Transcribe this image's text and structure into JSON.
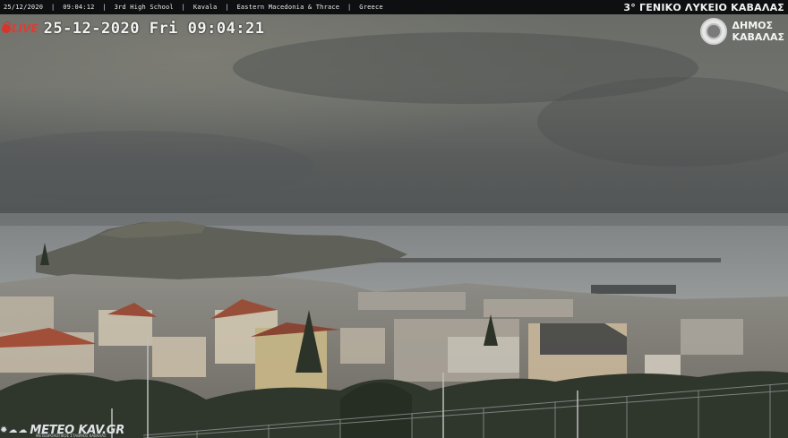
{
  "topbar": {
    "info": "25/12/2020  |  09:04:12  |  3rd High School  |  Kavala  |  Eastern Macedonia & Thrace  |  Greece",
    "school": "3° ΓΕΝΙΚΟ ΛΥΚΕΙΟ ΚΑΒΑΛΑΣ"
  },
  "overlay": {
    "live_label": "LIVE",
    "datetime": "25-12-2020 Fri 09:04:21"
  },
  "municipality": {
    "line1": "ΔΗΜΟΣ",
    "line2": "ΚΑΒΑΛΑΣ"
  },
  "watermark": {
    "brand": "METEO KAV.GR",
    "tagline": "ΜΕΤΕΩΡΟΛΟΓΙΚΟΣ ΣΤΑΘΜΟΣ ΚΑΒΑΛΑΣ"
  },
  "scene": {
    "description_icon": "webcam-landscape-image",
    "colors": {
      "sky": "#5c5f5c",
      "sea": "#8b8f90",
      "accent_live": "#d9342b"
    }
  }
}
